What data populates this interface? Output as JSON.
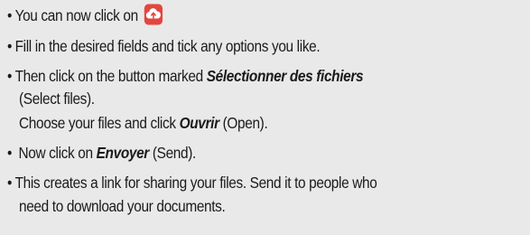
{
  "bullet_char": "•",
  "steps": [
    {
      "text": "You can now click on",
      "icon": "upload-cloud-icon"
    },
    {
      "text": "Fill in the desired fields and tick any options you like."
    },
    {
      "pre": "Then click on the button marked ",
      "emphasis": "Sélectionner des fichiers",
      "after": "(Select files).",
      "line2_pre": "Choose your files and click ",
      "line2_emphasis": "Ouvrir",
      "line2_post": " (Open)."
    },
    {
      "pre": " Now click on ",
      "emphasis": "Envoyer",
      "post": " (Send)."
    },
    {
      "text": "This creates a link for sharing your files. Send it to people who",
      "continued": "need to download your documents."
    }
  ],
  "colors": {
    "background": "#e9e9ea",
    "icon_red": "#e2463f"
  }
}
